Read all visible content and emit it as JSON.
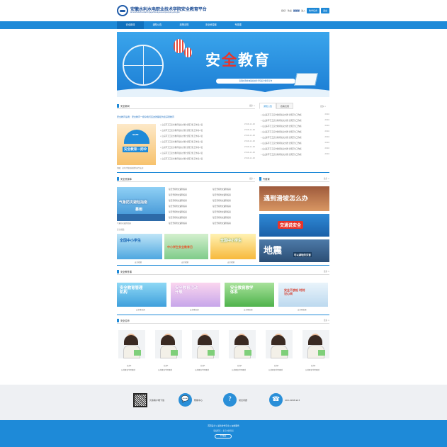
{
  "header": {
    "title": "安徽水利水电职业技术学院安全教育平台",
    "subtitle": "anhuishuilishuidianzhiyejishuxueyuananquanjiaoyupingtai",
    "logo_text": "EIC",
    "welcome": "您好！欢迎",
    "user": "颜颜颜",
    "login_link": "进入",
    "btn_study": "教学任务",
    "btn_exit": "退出"
  },
  "nav": [
    "安全新闻",
    "通知公告",
    "政策法规",
    "安全资源库",
    "专题课"
  ],
  "banner": {
    "title_a": "安",
    "title_b": "全",
    "title_c": "教育",
    "strip": "安徽水利水电职业技术学院安全教育平台"
  },
  "news": {
    "heading": "安全新闻",
    "more": "更多 >",
    "headline": "安全教育读者：安全教育一把伞我们应这张路径为您深受教育",
    "thumb_tag": "SAFE",
    "thumb_title": "安全教育一把伞",
    "thumb_caption": "消融：如何才能更规律的天生安全",
    "items": [
      {
        "t": "山东环卫工安全教育知识大赛 全国卫生工作者人员",
        "d": "2016-11-20"
      },
      {
        "t": "山东环卫工安全教育知识大赛 全国卫生工作者人员",
        "d": "2016-11-20"
      },
      {
        "t": "山东环卫工安全教育知识大赛 全国卫生工作者人员",
        "d": "2016-11-20"
      },
      {
        "t": "山东环卫工安全教育知识大赛 全国卫生工作者人员",
        "d": "2016-11-20"
      },
      {
        "t": "山东环卫工安全教育知识大赛 全国卫生工作者人员",
        "d": "2016-11-20"
      },
      {
        "t": "山东环卫工安全教育知识大赛 全国卫生工作者人员",
        "d": "2016-11-20"
      },
      {
        "t": "山东环卫工安全教育知识大赛 全国卫生工作者人员",
        "d": "2016-11-20"
      }
    ]
  },
  "notice": {
    "tab1": "通知公告",
    "tab2": "政策法规",
    "more": "更多 >",
    "items": [
      {
        "t": "山山东环卫工安全教育知识大赛 全国卫生工作者",
        "d": "2016"
      },
      {
        "t": "山山东环卫工安全教育知识大赛 全国卫生工作者",
        "d": "2016"
      },
      {
        "t": "山山东环卫工安全教育知识大赛 全国卫生工作者",
        "d": "2016"
      },
      {
        "t": "山山东环卫工安全教育知识大赛 全国卫生工作者",
        "d": "2016"
      },
      {
        "t": "山山东环卫工安全教育知识大赛 全国卫生工作者",
        "d": "2016"
      },
      {
        "t": "山山东环卫工安全教育知识大赛 全国卫生工作者",
        "d": "2016"
      },
      {
        "t": "山山东环卫工安全教育知识大赛 全国卫生工作者",
        "d": "2016"
      },
      {
        "t": "山山东环卫工安全教育知识大赛 全国卫生工作者",
        "d": "2016"
      }
    ]
  },
  "resources": {
    "heading": "安全资源库",
    "more": "更多 >",
    "thumb_title": "气象防灾避险指南",
    "thumb_sub": "暴雨",
    "thumb_caption": "气象防灾避险指南",
    "col1": [
      "每天坚持防灾避险指南",
      "每天坚持防灾避险指南",
      "每天坚持防灾避险指南",
      "每天坚持防灾避险指南",
      "每天坚持防灾避险指南",
      "每天坚持防灾避险指南",
      "每天坚持防灾避险指南"
    ],
    "col2": [
      "每天坚持防灾避险指南",
      "每天坚持防灾避险指南",
      "每天坚持防灾避险指南",
      "每天坚持防灾避险指南",
      "每天坚持防灾避险指南",
      "每天坚持防灾避险指南",
      "每天坚持防灾避险指南"
    ],
    "video_label": "安全视频",
    "videos": [
      {
        "title": "全国中小学生",
        "cap": "安全视频"
      },
      {
        "title": "中小学生安全教育日",
        "cap": "安全视频"
      },
      {
        "title": "全国中小学生",
        "cap": "安全视频"
      }
    ]
  },
  "topics": {
    "heading": "专题课",
    "more": "更多 >",
    "items": [
      "遇到滑坡怎么办",
      "交通说安全",
      "地震"
    ],
    "sub3": "可以减轻的灾害"
  },
  "edu": {
    "heading": "安全教育课",
    "more": "更多 >",
    "items": [
      {
        "title": "安全教育管理机构",
        "cap": "安全教育课"
      },
      {
        "title": "安全教育活动开展",
        "cap": "安全教育课"
      },
      {
        "title": "安全教育教学体系",
        "cap": "安全教育课"
      },
      {
        "title": "安全不放松 时刻记心间",
        "cap": "安全教育课"
      }
    ]
  },
  "teachers": {
    "heading": "安全名师",
    "more": "更多 >",
    "items": [
      {
        "name": "名师1",
        "desc": "公共教育学院教授"
      },
      {
        "name": "名师1",
        "desc": "公共教育学院教授"
      },
      {
        "name": "名师1",
        "desc": "公共教育学院教授"
      },
      {
        "name": "名师1",
        "desc": "公共教育学院教授"
      },
      {
        "name": "名师1",
        "desc": "公共教育学院教授"
      },
      {
        "name": "名师1",
        "desc": "公共教育学院教授"
      }
    ]
  },
  "footer": {
    "qr_label": "贝塞客户端下载",
    "help": "帮助中心",
    "faq": "常见问题",
    "phone": "400-0938-923",
    "links": "首页设计  |  最新合作平台  |  在线服务",
    "copyright": "版权所有：北京市教育局",
    "btn": "ICP备案"
  }
}
